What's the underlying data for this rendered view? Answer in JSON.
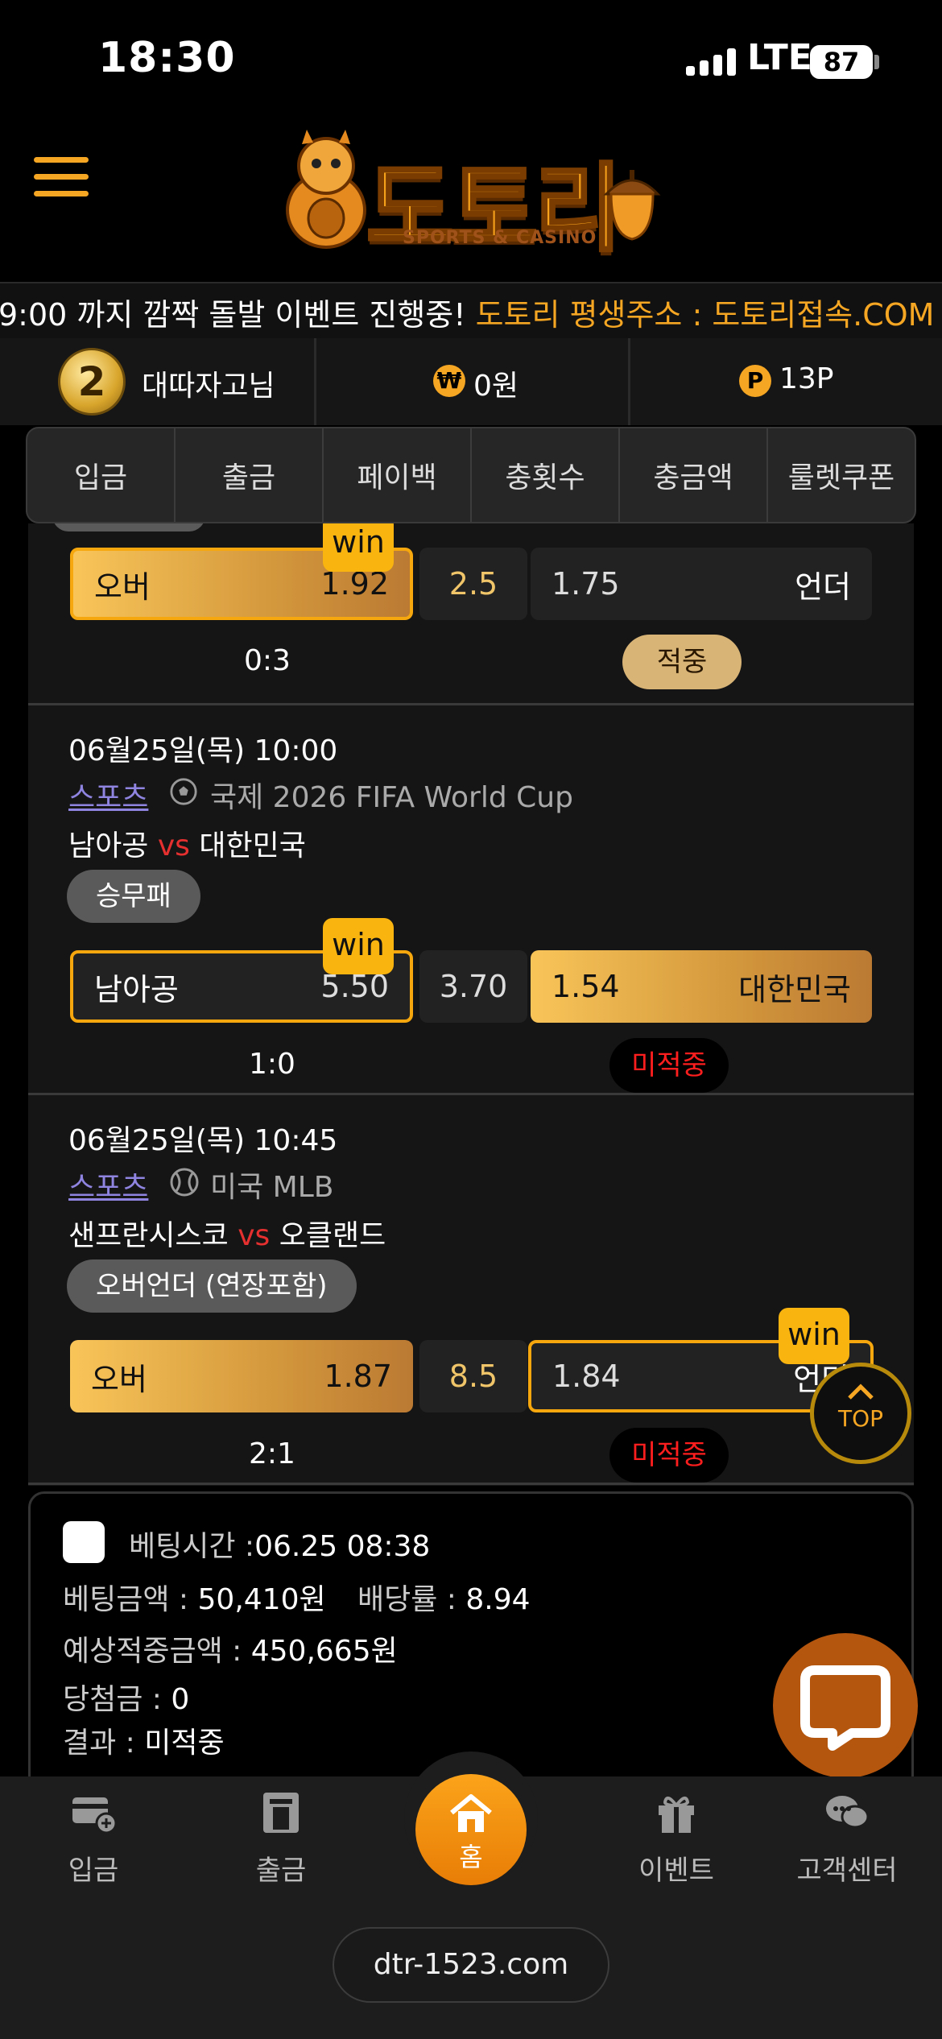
{
  "status": {
    "time": "18:30",
    "network": "LTE",
    "battery": "87"
  },
  "header": {
    "logo_text": "도토리",
    "logo_sub": "SPORTS & CASINO"
  },
  "marquee": {
    "text": "9:00 까지 깜짝 돌발 이벤트 진행중! 도토리 평생주소 : 도토리접속.COM"
  },
  "userbar": {
    "level": "2",
    "nickname": "대따자고님",
    "money_symbol": "₩",
    "money": "0원",
    "point_symbol": "P",
    "points": "13P"
  },
  "tabs": [
    "입금",
    "출금",
    "페이백",
    "충횟수",
    "충금액",
    "룰렛쿠폰"
  ],
  "bets": [
    {
      "home_label": "오버",
      "home_odds": "1.92",
      "mid": "2.5",
      "away_odds": "1.75",
      "away_label": "언더",
      "win_badge": "win",
      "score": "0:3",
      "result": "적중"
    },
    {
      "datetime": "06월25일(목) 10:00",
      "category": "스포츠",
      "league": "국제 2026 FIFA World Cup",
      "home_team": "남아공",
      "vs": "vs",
      "away_team": "대한민국",
      "bet_type": "승무패",
      "home_label": "남아공",
      "home_odds": "5.50",
      "mid": "3.70",
      "away_odds": "1.54",
      "away_label": "대한민국",
      "win_badge": "win",
      "score": "1:0",
      "result": "미적중"
    },
    {
      "datetime": "06월25일(목) 10:45",
      "category": "스포츠",
      "league": "미국 MLB",
      "home_team": "샌프란시스코",
      "vs": "vs",
      "away_team": "오클랜드",
      "bet_type": "오버언더 (연장포함)",
      "home_label": "오버",
      "home_odds": "1.87",
      "mid": "8.5",
      "away_odds": "1.84",
      "away_label": "언더",
      "win_badge": "win",
      "score": "2:1",
      "result": "미적중"
    }
  ],
  "top_button": "TOP",
  "summary": {
    "bet_time_label": "베팅시간 :",
    "bet_time": "06.25 08:38",
    "amount_label": "베팅금액 :",
    "amount": "50,410원",
    "rate_label": "배당률 :",
    "rate": "8.94",
    "expected_label": "예상적중금액 :",
    "expected": "450,665원",
    "prize_label": "당첨금 :",
    "prize": "0",
    "result_label": "결과 :",
    "result": "미적중"
  },
  "bottom_nav": [
    "입금",
    "출금",
    "홈",
    "이벤트",
    "고객센터"
  ],
  "url": "dtr-1523.com",
  "colors": {
    "accent": "#f5a623",
    "hit": "#d8b477",
    "miss": "#ff1e1e",
    "vs": "#e63030"
  }
}
